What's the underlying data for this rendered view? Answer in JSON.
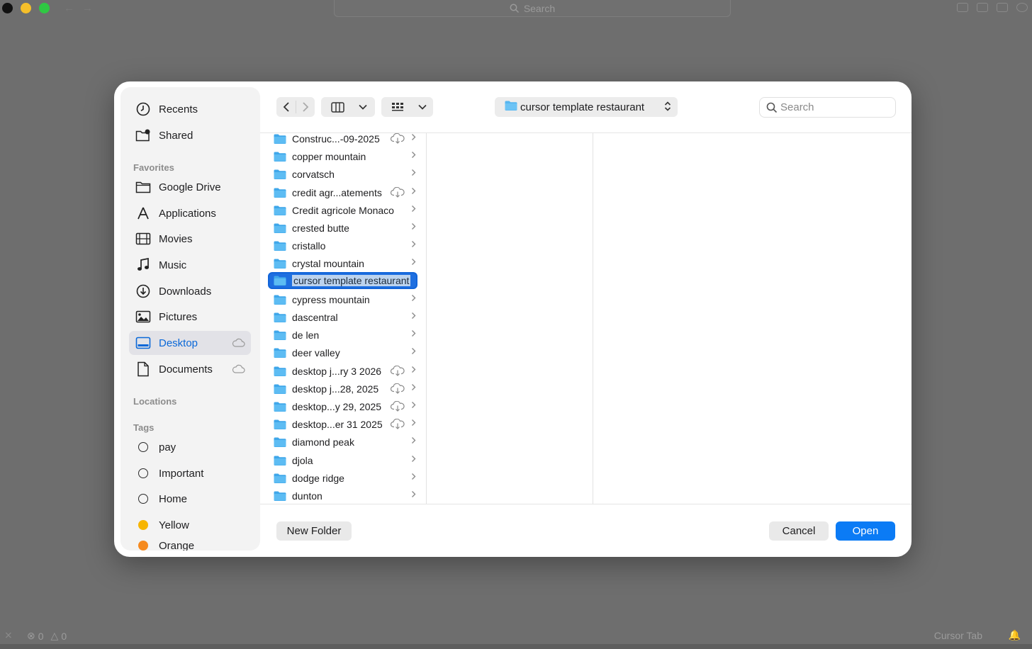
{
  "window": {
    "search_placeholder": "Search",
    "status_errors": "0",
    "status_warnings": "0",
    "status_right": "Cursor Tab"
  },
  "dialog": {
    "sidebar": {
      "top_items": [
        {
          "label": "Recents",
          "icon": "clock-icon"
        },
        {
          "label": "Shared",
          "icon": "shared-folder-icon"
        }
      ],
      "favorites_heading": "Favorites",
      "favorites": [
        {
          "label": "Google Drive",
          "icon": "folder-icon"
        },
        {
          "label": "Applications",
          "icon": "applications-icon"
        },
        {
          "label": "Movies",
          "icon": "film-icon"
        },
        {
          "label": "Music",
          "icon": "music-note-icon"
        },
        {
          "label": "Downloads",
          "icon": "download-icon"
        },
        {
          "label": "Pictures",
          "icon": "photo-icon"
        },
        {
          "label": "Desktop",
          "icon": "desktop-icon"
        },
        {
          "label": "Documents",
          "icon": "document-icon"
        }
      ],
      "locations_heading": "Locations",
      "tags_heading": "Tags",
      "tags": [
        {
          "label": "pay",
          "color": ""
        },
        {
          "label": "Important",
          "color": ""
        },
        {
          "label": "Home",
          "color": ""
        },
        {
          "label": "Yellow",
          "color": "#f7b500"
        },
        {
          "label": "Orange",
          "color": "#f58a1f"
        }
      ]
    },
    "toolbar": {
      "current_folder": "cursor template restaurant",
      "search_placeholder": "Search"
    },
    "files": [
      {
        "name": "Construc...-09-2025",
        "cloud": true
      },
      {
        "name": "copper mountain",
        "cloud": false
      },
      {
        "name": "corvatsch",
        "cloud": false
      },
      {
        "name": "credit agr...atements",
        "cloud": true
      },
      {
        "name": "Credit agricole Monaco",
        "cloud": false
      },
      {
        "name": "crested butte",
        "cloud": false
      },
      {
        "name": "cristallo",
        "cloud": false
      },
      {
        "name": "crystal mountain",
        "cloud": false
      },
      {
        "name": "cursor template restaurant",
        "cloud": false,
        "selected": true
      },
      {
        "name": "cypress mountain",
        "cloud": false
      },
      {
        "name": "dascentral",
        "cloud": false
      },
      {
        "name": "de len",
        "cloud": false
      },
      {
        "name": "deer valley",
        "cloud": false
      },
      {
        "name": "desktop j...ry 3 2026",
        "cloud": true
      },
      {
        "name": "desktop j...28, 2025",
        "cloud": true
      },
      {
        "name": "desktop...y 29, 2025",
        "cloud": true
      },
      {
        "name": "desktop...er 31 2025",
        "cloud": true
      },
      {
        "name": "diamond peak",
        "cloud": false
      },
      {
        "name": "djola",
        "cloud": false
      },
      {
        "name": "dodge ridge",
        "cloud": false
      },
      {
        "name": "dunton",
        "cloud": false
      }
    ],
    "buttons": {
      "new_folder": "New Folder",
      "cancel": "Cancel",
      "open": "Open"
    },
    "colors": {
      "accent": "#0b7bf5",
      "folder": "#56b6f0",
      "sidebar_active_text": "#0a68d8"
    }
  }
}
